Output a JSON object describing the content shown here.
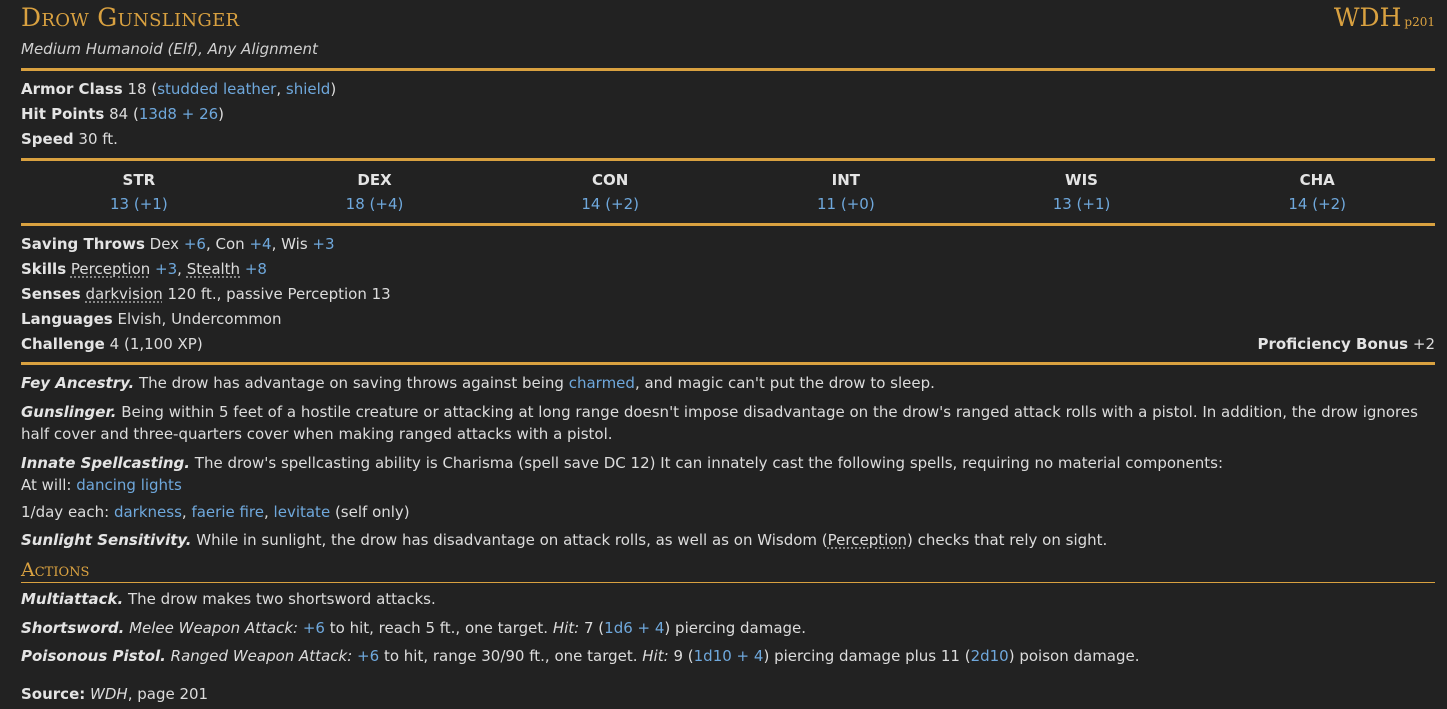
{
  "name": "Drow Gunslinger",
  "source_abbr": "WDH",
  "source_page": "p201",
  "type_line": "Medium Humanoid (Elf), Any Alignment",
  "ac": {
    "label": "Armor Class",
    "value": "18",
    "armor1": "studded leather",
    "armor2": "shield"
  },
  "hp": {
    "label": "Hit Points",
    "value": "84",
    "formula": "13d8 + 26"
  },
  "speed": {
    "label": "Speed",
    "value": "30 ft."
  },
  "abilities": [
    {
      "name": "STR",
      "score": "13 (+1)"
    },
    {
      "name": "DEX",
      "score": "18 (+4)"
    },
    {
      "name": "CON",
      "score": "14 (+2)"
    },
    {
      "name": "INT",
      "score": "11 (+0)"
    },
    {
      "name": "WIS",
      "score": "13 (+1)"
    },
    {
      "name": "CHA",
      "score": "14 (+2)"
    }
  ],
  "saves": {
    "label": "Saving Throws",
    "dex": "Dex",
    "dex_b": "+6",
    "con": "Con",
    "con_b": "+4",
    "wis": "Wis",
    "wis_b": "+3"
  },
  "skills": {
    "label": "Skills",
    "s1": "Perception",
    "s1_b": "+3",
    "s2": "Stealth",
    "s2_b": "+8"
  },
  "senses": {
    "label": "Senses",
    "sense": "darkvision",
    "rest": "120 ft., passive Perception 13"
  },
  "languages": {
    "label": "Languages",
    "value": "Elvish, Undercommon"
  },
  "challenge": {
    "label": "Challenge",
    "value": "4",
    "xp": "(1,100 XP)",
    "pb_label": "Proficiency Bonus",
    "pb_value": "+2"
  },
  "traits": {
    "fey": {
      "name": "Fey Ancestry.",
      "t1": "The drow has advantage on saving throws against being",
      "link": "charmed",
      "t2": ", and magic can't put the drow to sleep."
    },
    "gun": {
      "name": "Gunslinger.",
      "t1": "Being within 5 feet of a hostile creature or attacking at long range doesn't impose disadvantage on the drow's ranged attack rolls with a pistol. In addition, the drow ignores half cover and three-quarters cover when making ranged attacks with a pistol."
    },
    "innate": {
      "name": "Innate Spellcasting.",
      "t1": "The drow's spellcasting ability is Charisma (spell save DC 12) It can innately cast the following spells, requiring no material components:",
      "atwill_label": "At will:",
      "atwill_spell": "dancing lights",
      "daily_label": "1/day each:",
      "daily_s1": "darkness",
      "daily_s2": "faerie fire",
      "daily_s3": "levitate",
      "daily_note": "(self only)"
    },
    "sun": {
      "name": "Sunlight Sensitivity.",
      "t1": "While in sunlight, the drow has disadvantage on attack rolls, as well as on Wisdom (",
      "skill": "Perception",
      "t2": ") checks that rely on sight."
    }
  },
  "actions_title": "Actions",
  "actions": {
    "multi": {
      "name": "Multiattack.",
      "t1": "The drow makes two shortsword attacks."
    },
    "sword": {
      "name": "Shortsword.",
      "kind": "Melee Weapon Attack:",
      "bonus": "+6",
      "t1": "to hit, reach 5 ft., one target.",
      "hit": "Hit:",
      "dmg": "7",
      "dice": "1d6 + 4",
      "t2": "piercing damage."
    },
    "pistol": {
      "name": "Poisonous Pistol.",
      "kind": "Ranged Weapon Attack:",
      "bonus": "+6",
      "t1": "to hit, range 30/90 ft., one target.",
      "hit": "Hit:",
      "dmg": "9",
      "dice": "1d10 + 4",
      "t2": "piercing damage plus 11",
      "dice2": "2d10",
      "t3": "poison damage."
    }
  },
  "source": {
    "label": "Source:",
    "book": "WDH",
    "page": ", page 201"
  }
}
